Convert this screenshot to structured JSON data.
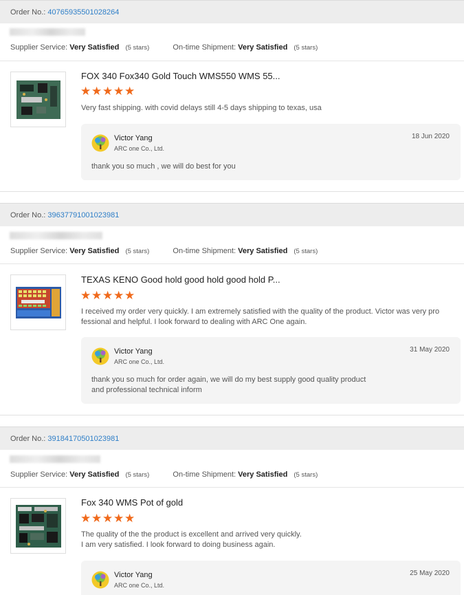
{
  "orders": [
    {
      "order_label": "Order No.:",
      "order_no": "40765935501028264",
      "supplier_label": "Supplier Service:",
      "supplier_value": "Very Satisfied",
      "supplier_stars": "(5 stars)",
      "shipment_label": "On-time Shipment:",
      "shipment_value": "Very Satisfied",
      "shipment_stars": "(5 stars)",
      "product_name": "FOX 340 Fox340 Gold Touch WMS550 WMS 55...",
      "rating": 5,
      "review": [
        "Very fast shipping. with covid delays still 4-5 days shipping to texas, usa"
      ],
      "reply": {
        "name": "Victor Yang",
        "company": "ARC one Co., Ltd.",
        "date": "18 Jun 2020",
        "text": [
          "thank you so much , we will do best for you"
        ]
      }
    },
    {
      "order_label": "Order No.:",
      "order_no": "39637791001023981",
      "supplier_label": "Supplier Service:",
      "supplier_value": "Very Satisfied",
      "supplier_stars": "(5 stars)",
      "shipment_label": "On-time Shipment:",
      "shipment_value": "Very Satisfied",
      "shipment_stars": "(5 stars)",
      "product_name": "TEXAS KENO Good hold good hold good hold P...",
      "rating": 5,
      "review": [
        "I received my order very quickly. I am extremely satisfied with the quality of the product. Victor was very pro",
        "fessional and helpful. I look forward to dealing with ARC One again."
      ],
      "reply": {
        "name": "Victor Yang",
        "company": "ARC one Co., Ltd.",
        "date": "31 May 2020",
        "text": [
          "thank you so much for order again, we will do my best supply good quality product",
          "and professional technical inform"
        ]
      }
    },
    {
      "order_label": "Order No.:",
      "order_no": "39184170501023981",
      "supplier_label": "Supplier Service:",
      "supplier_value": "Very Satisfied",
      "supplier_stars": "(5 stars)",
      "shipment_label": "On-time Shipment:",
      "shipment_value": "Very Satisfied",
      "shipment_stars": "(5 stars)",
      "product_name": "Fox 340 WMS Pot of gold",
      "rating": 5,
      "review": [
        "The quality of the the product is excellent and arrived very quickly.",
        "I am very satisfied. I look forward to doing business again."
      ],
      "reply": {
        "name": "Victor Yang",
        "company": "ARC one Co., Ltd.",
        "date": "25 May 2020",
        "text": []
      }
    }
  ],
  "colors": {
    "link": "#2f7fc8",
    "star": "#f06a1c",
    "header_bg": "#ededed",
    "reply_bg": "#f4f4f4"
  },
  "icons": {
    "star": "star-icon",
    "avatar": "tree-logo-avatar"
  }
}
